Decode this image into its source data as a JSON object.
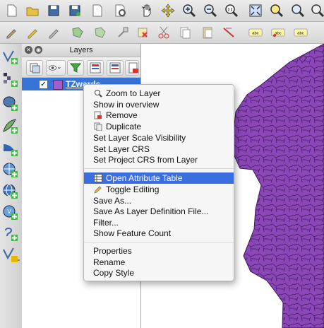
{
  "toolbars": {
    "top_icons": [
      "new-project-icon",
      "open-project-icon",
      "save-project-icon",
      "save-as-icon",
      "new-print-composer-icon",
      "composer-manager-icon",
      "pan-icon",
      "pan-to-selection-icon",
      "zoom-in-icon",
      "zoom-out-icon",
      "zoom-actual-icon",
      "zoom-full-icon",
      "zoom-to-selection-icon",
      "zoom-to-layer-icon",
      "zoom-last-icon"
    ],
    "second_icons": [
      "current-edits-icon",
      "toggle-editing-icon",
      "save-edits-icon",
      "add-feature-icon",
      "move-feature-icon",
      "node-tool-icon",
      "delete-selected-icon",
      "cut-features-icon",
      "copy-features-icon",
      "paste-features-icon",
      "label-icon",
      "pin-label-icon",
      "highlight-label-icon",
      "move-label-icon"
    ],
    "left_icons": [
      "add-vector-layer-icon",
      "add-raster-layer-icon",
      "add-postgis-layer-icon",
      "add-spatialite-layer-icon",
      "add-mssql-layer-icon",
      "add-oracle-layer-icon",
      "add-wms-layer-icon",
      "add-wcs-layer-icon",
      "add-wfs-layer-icon",
      "add-delimited-text-icon",
      "new-shapefile-icon"
    ]
  },
  "layers_panel": {
    "title": "Layers",
    "tools": [
      "add-group-icon",
      "manage-visibility-icon",
      "filter-legend-icon",
      "expand-all-icon",
      "collapse-all-icon",
      "remove-layer-icon"
    ],
    "layer": {
      "name": "TZwards",
      "checked": "✓",
      "swatch_color": "#a35ec9"
    }
  },
  "context_menu": {
    "items": [
      {
        "label": "Zoom to Layer",
        "icon": "zoom-to-layer-icon"
      },
      {
        "label": "Show in overview"
      },
      {
        "label": "Remove",
        "icon": "remove-icon"
      },
      {
        "label": "Duplicate",
        "icon": "duplicate-icon"
      },
      {
        "label": "Set Layer Scale Visibility"
      },
      {
        "label": "Set Layer CRS"
      },
      {
        "label": "Set Project CRS from Layer"
      },
      {
        "label": "Open Attribute Table",
        "icon": "attribute-table-icon",
        "selected": true
      },
      {
        "label": "Toggle Editing",
        "icon": "pencil-icon"
      },
      {
        "label": "Save As..."
      },
      {
        "label": "Save As Layer Definition File..."
      },
      {
        "label": "Filter..."
      },
      {
        "label": "Show Feature Count"
      },
      {
        "label": "Properties"
      },
      {
        "label": "Rename"
      },
      {
        "label": "Copy Style"
      }
    ]
  },
  "map": {
    "fill_color": "#8b46b8",
    "edge_color": "#3a1a55"
  }
}
